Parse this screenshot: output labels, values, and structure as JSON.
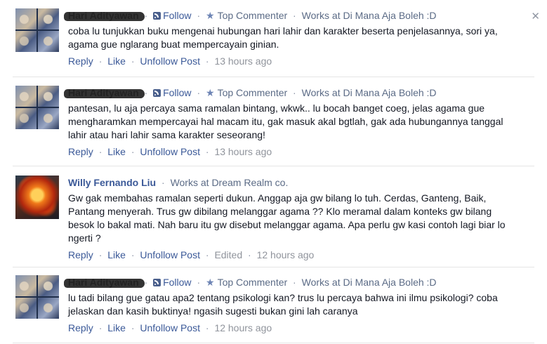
{
  "comments": [
    {
      "author": "Hari Adityawan",
      "follow": "Follow",
      "badge": "Top Commenter",
      "work": "Works at Di Mana Aja Boleh :D",
      "text": "coba lu tunjukkan buku mengenai hubungan hari lahir dan karakter beserta penjelasannya, sori ya, agama gue nglarang buat mempercayain ginian.",
      "reply": "Reply",
      "like": "Like",
      "unfollow": "Unfollow Post",
      "time": "13 hours ago"
    },
    {
      "author": "Hari Adityawan",
      "follow": "Follow",
      "badge": "Top Commenter",
      "work": "Works at Di Mana Aja Boleh :D",
      "text": "pantesan, lu aja percaya sama ramalan bintang, wkwk.. lu bocah banget coeg, jelas agama gue mengharamkan mempercayai hal macam itu, gak masuk akal bgtlah, gak ada hubungannya tanggal lahir atau hari lahir sama karakter seseorang!",
      "reply": "Reply",
      "like": "Like",
      "unfollow": "Unfollow Post",
      "time": "13 hours ago"
    },
    {
      "author": "Willy Fernando Liu",
      "work_prefix": "Works at",
      "work_place": "Dream Realm co.",
      "text": "Gw gak membahas ramalan seperti dukun. Anggap aja gw bilang lo tuh. Cerdas, Ganteng, Baik, Pantang menyerah. Trus gw dibilang melanggar agama ?? Klo meramal dalam konteks gw bilang besok lo bakal mati. Nah baru itu gw disebut melanggar agama. Apa perlu gw kasi contoh lagi biar lo ngerti ?",
      "reply": "Reply",
      "like": "Like",
      "unfollow": "Unfollow Post",
      "edited": "Edited",
      "time": "12 hours ago"
    },
    {
      "author": "Hari Adityawan",
      "follow": "Follow",
      "badge": "Top Commenter",
      "work": "Works at Di Mana Aja Boleh :D",
      "text": "lu tadi bilang gue gatau apa2 tentang psikologi kan? trus lu percaya bahwa ini ilmu psikologi? coba jelaskan dan kasih buktinya! ngasih sugesti bukan gini lah caranya",
      "reply": "Reply",
      "like": "Like",
      "unfollow": "Unfollow Post",
      "time": "12 hours ago"
    }
  ],
  "close_glyph": "✕",
  "separator": "·",
  "star_glyph": "★"
}
